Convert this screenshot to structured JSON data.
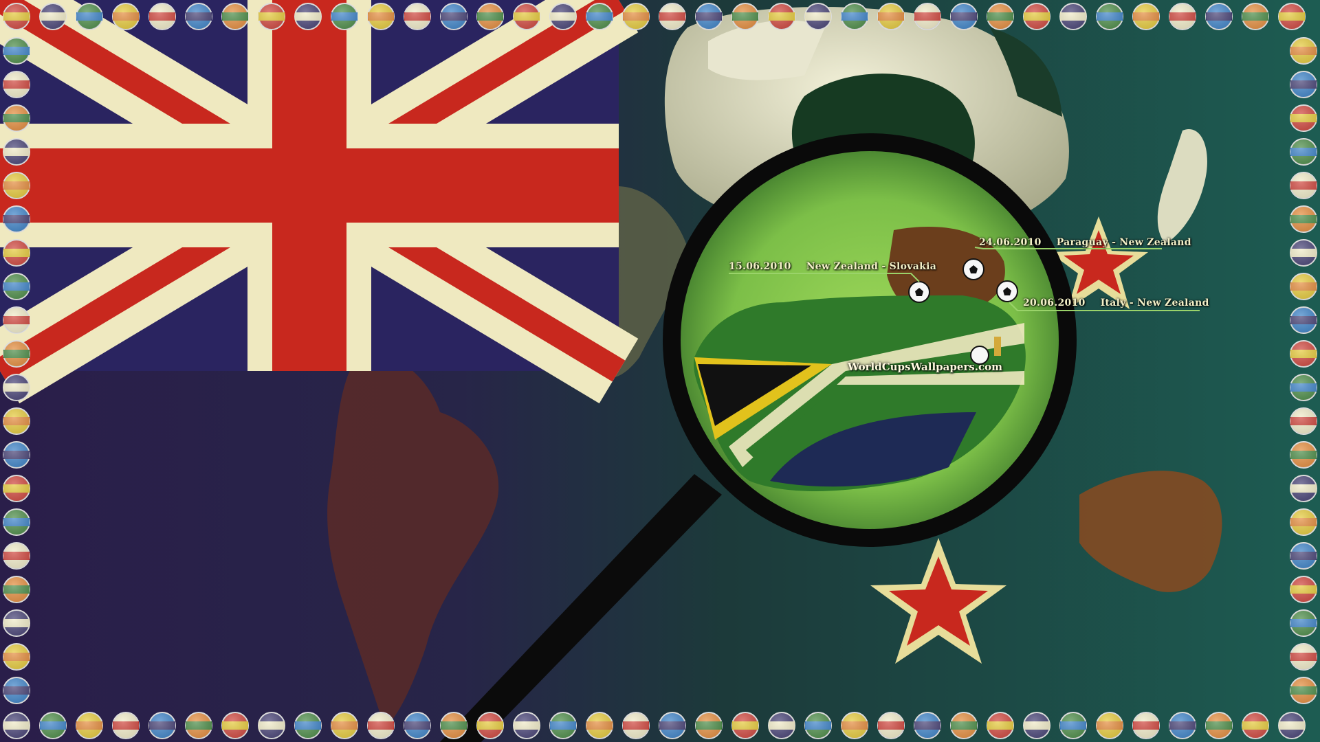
{
  "fixtures": [
    {
      "date": "15.06.2010",
      "match": "New Zealand - Slovakia"
    },
    {
      "date": "24.06.2010",
      "match": "Paraguay - New Zealand"
    },
    {
      "date": "20.06.2010",
      "match": "Italy - New Zealand"
    }
  ],
  "watermark": "WorldCupsWallpapers.com",
  "colors": {
    "flag_red": "#c8281e",
    "flag_white": "#efe9c0",
    "flag_blue": "#2a2460",
    "sa_green": "#2f7a2a",
    "sa_gold": "#e2c21c",
    "sea_green": "#1f5a4e"
  },
  "flag_icons": [
    "south-africa",
    "australia",
    "ivory-coast",
    "korea",
    "netherlands",
    "portugal",
    "japan",
    "italy",
    "honduras",
    "usa",
    "argentina",
    "north-korea",
    "england",
    "italy",
    "cameroon",
    "new-zealand",
    "switzerland",
    "chile",
    "uruguay",
    "south-africa",
    "australia",
    "ivory-coast",
    "korea",
    "netherlands",
    "portugal",
    "japan",
    "italy",
    "honduras",
    "usa",
    "argentina",
    "north-korea",
    "england",
    "nigeria",
    "cameroon",
    "new-zealand",
    "switzerland"
  ]
}
